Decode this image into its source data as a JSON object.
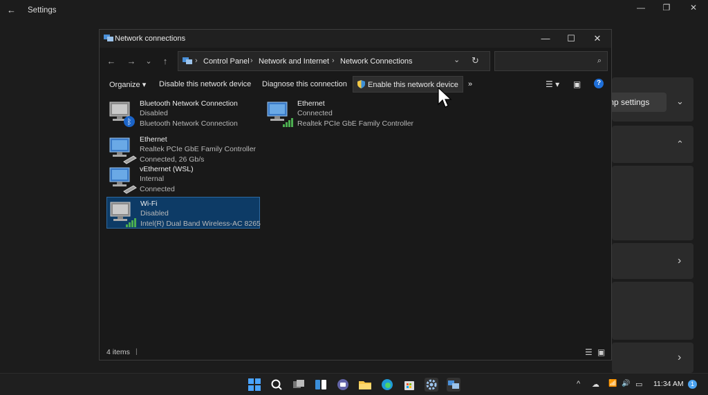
{
  "settings": {
    "title": "Settings",
    "back_icon": "←",
    "window_buttons": [
      "—",
      "❐",
      "✕"
    ],
    "bg_button_label": "mp settings",
    "chevrons": [
      "⌄",
      "⌃",
      "›",
      "›"
    ]
  },
  "window": {
    "title": "Network connections",
    "minimize": "—",
    "maximize": "☐",
    "close": "✕"
  },
  "nav": {
    "back": "←",
    "forward": "→",
    "recent": "⌄",
    "up": "↑",
    "breadcrumb": [
      "Control Panel",
      "Network and Internet",
      "Network Connections"
    ],
    "separator": "›",
    "dropdown": "⌄",
    "refresh": "↻",
    "search_placeholder": "",
    "search_icon": "⌕"
  },
  "commands": {
    "organize": "Organize ▾",
    "disable": "Disable this network device",
    "diagnose": "Diagnose this connection",
    "enable": "Enable this network device",
    "more": "»",
    "change_view": "☰ ▾",
    "preview_pane": "▣",
    "help": "?"
  },
  "connections": [
    {
      "name": "Bluetooth Network Connection",
      "status": "Disabled",
      "device": "Bluetooth Network Connection",
      "type": "bluetooth",
      "selected": false
    },
    {
      "name": "Ethernet",
      "status": "Connected",
      "device": "Realtek PCIe GbE Family Controller",
      "type": "signal",
      "selected": false
    },
    {
      "name": "Ethernet",
      "status": "Realtek PCIe GbE Family Controller",
      "device": "Connected, 26 Gb/s",
      "type": "cable",
      "selected": false
    },
    {
      "name": "vEthernet (WSL)",
      "status": "Internal",
      "device": "Connected",
      "type": "cable",
      "selected": false
    },
    {
      "name": "Wi-Fi",
      "status": "Disabled",
      "device": "Intel(R) Dual Band Wireless-AC 8265",
      "type": "signal",
      "selected": true
    }
  ],
  "status": {
    "count": "4 items",
    "sep": "|",
    "details_view": "☰",
    "large_icons_view": "▣"
  },
  "taskbar": {
    "tray_chevron": "^",
    "tray_cloud": "☁",
    "tray_wifi": "📶",
    "tray_volume": "🔊",
    "tray_battery": "▭",
    "time": "11:34 AM",
    "notifications": "1"
  },
  "colors": {
    "accent": "#0d3b66",
    "window_bg": "#191919",
    "signal_green": "#4caf50"
  }
}
